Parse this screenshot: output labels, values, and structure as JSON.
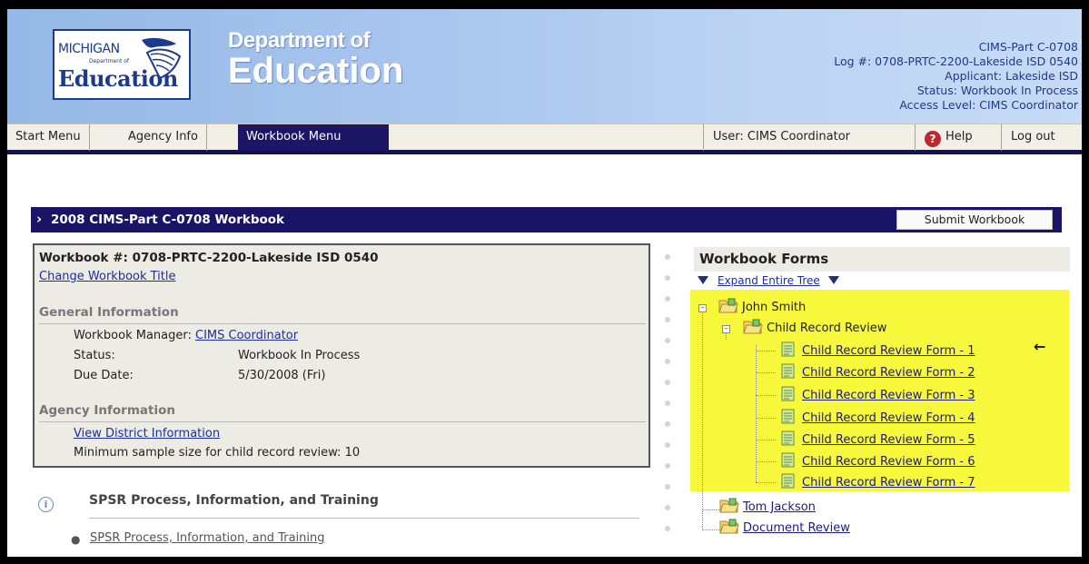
{
  "header": {
    "logo": {
      "state": "MICHIGAN",
      "subtitle": "Department of",
      "word": "Education"
    },
    "title_line1": "Department of",
    "title_line2": "Education",
    "info": {
      "line1": "CIMS-Part C-0708",
      "line2": "Log #: 0708-PRTC-2200-Lakeside ISD 0540",
      "line3": "Applicant: Lakeside ISD",
      "line4": "Status: Workbook In Process",
      "line5": "Access Level: CIMS Coordinator"
    }
  },
  "nav": {
    "start_menu": "Start Menu",
    "agency_info": "Agency Info",
    "workbook_menu": "Workbook Menu",
    "user": "User: CIMS Coordinator",
    "help": "Help",
    "logout": "Log out"
  },
  "workbook_bar": {
    "title": "2008 CIMS-Part C-0708 Workbook",
    "submit_label": "Submit Workbook"
  },
  "info_panel": {
    "workbook_number": "Workbook #: 0708-PRTC-2200-Lakeside ISD 0540",
    "change_title_link": "Change Workbook Title",
    "general_heading": "General Information",
    "manager_label": "Workbook Manager:",
    "manager_value": "CIMS Coordinator",
    "status_label": "Status:",
    "status_value": "Workbook In Process",
    "due_label": "Due Date:",
    "due_value": "5/30/2008 (Fri)",
    "agency_heading": "Agency Information",
    "view_district_link": "View District Information",
    "min_sample": "Minimum sample size for child record review: 10"
  },
  "spsr": {
    "heading": "SPSR Process, Information, and Training",
    "link": "SPSR Process, Information, and Training"
  },
  "workbook_forms": {
    "heading": "Workbook Forms",
    "expand_label": "Expand Entire Tree",
    "tree": {
      "john_smith": "John Smith",
      "child_record_review": "Child Record Review",
      "forms": [
        "Child Record Review Form - 1",
        "Child Record Review Form - 2",
        "Child Record Review Form - 3",
        "Child Record Review Form - 4",
        "Child Record Review Form - 5",
        "Child Record Review Form - 6",
        "Child Record Review Form - 7"
      ],
      "tom_jackson": "Tom Jackson",
      "document_review": "Document Review"
    },
    "arrow": "←"
  },
  "colors": {
    "nav_active": "#1c1664",
    "header_bar": "#1a1467",
    "highlight": "#f7f73b",
    "link": "#1d2ea1"
  }
}
